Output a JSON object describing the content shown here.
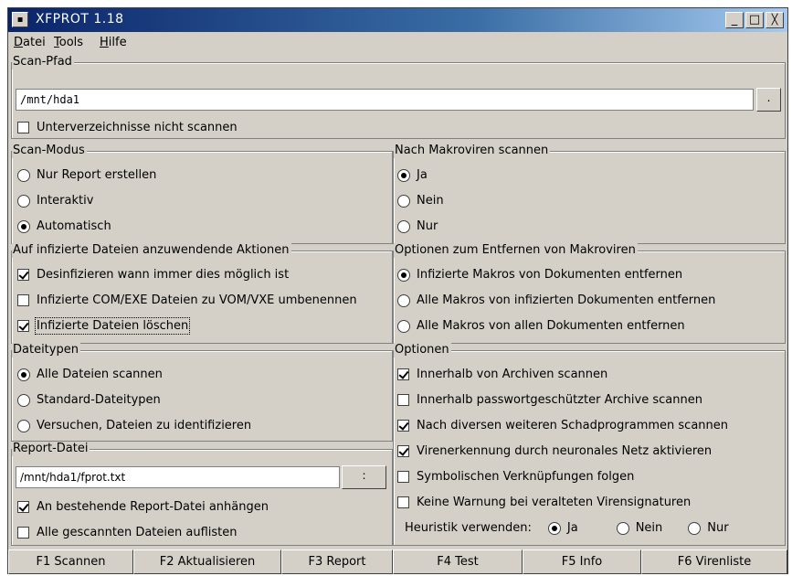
{
  "window": {
    "title": "XFPROT 1.18",
    "sys_glyph": "▪",
    "min_glyph": "_",
    "max_glyph": "□",
    "close_glyph": "╳"
  },
  "menu": {
    "datei": {
      "accel": "D",
      "rest": "atei"
    },
    "tools": {
      "accel": "T",
      "rest": "ools"
    },
    "hilfe": {
      "accel": "H",
      "rest": "ilfe"
    }
  },
  "scan_path": {
    "title": "Scan-Pfad",
    "value": "/mnt/hda1",
    "browse_label": ".",
    "no_subdirs_label": "Unterverzeichnisse nicht scannen",
    "no_subdirs_checked": false
  },
  "scan_mode": {
    "title": "Scan-Modus",
    "options": [
      "Nur Report erstellen",
      "Interaktiv",
      "Automatisch"
    ],
    "selected": 2
  },
  "macro_scan": {
    "title": "Nach Makroviren scannen",
    "options": [
      "Ja",
      "Nein",
      "Nur"
    ],
    "selected": 0
  },
  "infected_actions": {
    "title": "Auf infizierte Dateien anzuwendende Aktionen",
    "items": [
      {
        "label": "Desinfizieren wann immer dies möglich ist",
        "checked": true
      },
      {
        "label": "Infizierte COM/EXE Dateien zu VOM/VXE umbenennen",
        "checked": false
      },
      {
        "label": "Infizierte Dateien löschen",
        "checked": true
      }
    ]
  },
  "macro_removal": {
    "title": "Optionen zum Entfernen von Makroviren",
    "options": [
      "Infizierte Makros von Dokumenten entfernen",
      "Alle Makros von infizierten Dokumenten entfernen",
      "Alle Makros von allen Dokumenten entfernen"
    ],
    "selected": 0
  },
  "file_types": {
    "title": "Dateitypen",
    "options": [
      "Alle Dateien scannen",
      "Standard-Dateitypen",
      "Versuchen, Dateien zu identifizieren"
    ],
    "selected": 0
  },
  "options": {
    "title": "Optionen",
    "items": [
      {
        "label": "Innerhalb von Archiven scannen",
        "checked": true
      },
      {
        "label": "Innerhalb passwortgeschützter Archive scannen",
        "checked": false
      },
      {
        "label": "Nach diversen weiteren Schadprogrammen scannen",
        "checked": true
      },
      {
        "label": "Virenerkennung durch neuronales Netz aktivieren",
        "checked": true
      },
      {
        "label": "Symbolischen Verknüpfungen folgen",
        "checked": false
      },
      {
        "label": "Keine Warnung bei veralteten Virensignaturen",
        "checked": false
      }
    ],
    "heuristic_label": "Heuristik verwenden:",
    "heuristic_options": [
      "Ja",
      "Nein",
      "Nur"
    ],
    "heuristic_selected": 0
  },
  "report_file": {
    "title": "Report-Datei",
    "value": "/mnt/hda1/fprot.txt",
    "browse_label": ":",
    "items": [
      {
        "label": "An bestehende Report-Datei anhängen",
        "checked": true
      },
      {
        "label": "Alle gescannten Dateien auflisten",
        "checked": false
      }
    ]
  },
  "function_keys": [
    "F1 Scannen",
    "F2 Aktualisieren",
    "F3 Report",
    "F4 Test",
    "F5 Info",
    "F6 Virenliste"
  ]
}
